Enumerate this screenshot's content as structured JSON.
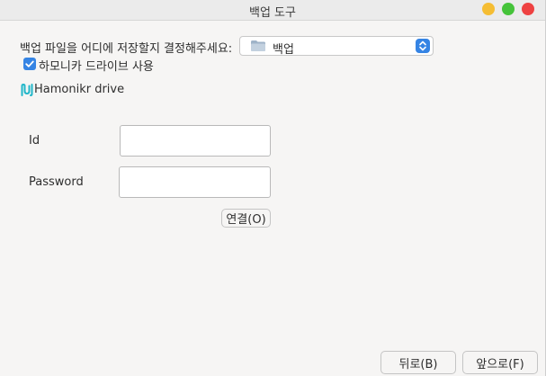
{
  "window": {
    "title": "백업 도구"
  },
  "backup_location": {
    "prompt": "백업 파일을 어디에 저장할지 결정해주세요:",
    "selected_folder": "백업",
    "folder_icon": "folder-icon",
    "selector_icon": "up-down-chevron-icon"
  },
  "hamonikr_drive": {
    "checkbox_label": "하모니카 드라이브 사용",
    "checked": true,
    "logo_icon": "hamonikr-logo-icon",
    "name": "Hamonikr drive"
  },
  "login": {
    "id_label": "Id",
    "id_value": "",
    "password_label": "Password",
    "password_value": "",
    "connect_label": "연결(O)"
  },
  "footer": {
    "back_label": "뒤로(B)",
    "next_label": "앞으로(F)"
  },
  "colors": {
    "accent": "#3584e4",
    "minimize": "#f5bd33",
    "maximize": "#45c33a",
    "close": "#ee4242",
    "logo": "#21b6c9"
  }
}
